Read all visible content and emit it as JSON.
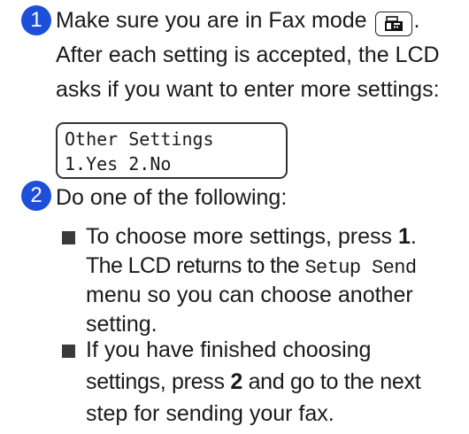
{
  "step1": {
    "number": "1",
    "line1_before": "Make sure you are in Fax mode",
    "line1_after": ".",
    "fax_icon": "fax-icon",
    "line2": "After each setting is accepted, the LCD",
    "line3": "asks if you want to enter more settings:"
  },
  "lcd": {
    "line1": "Other Settings",
    "line2": "1.Yes 2.No"
  },
  "step2": {
    "number": "2",
    "intro": "Do one of the following:",
    "bullet1": {
      "l1_pre": "To choose more settings, press ",
      "l1_key": "1",
      "l1_post": ".",
      "l2_pre": "The LCD returns to the ",
      "l2_menu": "Setup Send",
      "l3": "menu so you can choose another",
      "l4": "setting."
    },
    "bullet2": {
      "l1": "If you have finished choosing",
      "l2_pre": "settings, press ",
      "l2_key": "2",
      "l2_post": " and go to the next",
      "l3": "step for sending your fax."
    }
  }
}
